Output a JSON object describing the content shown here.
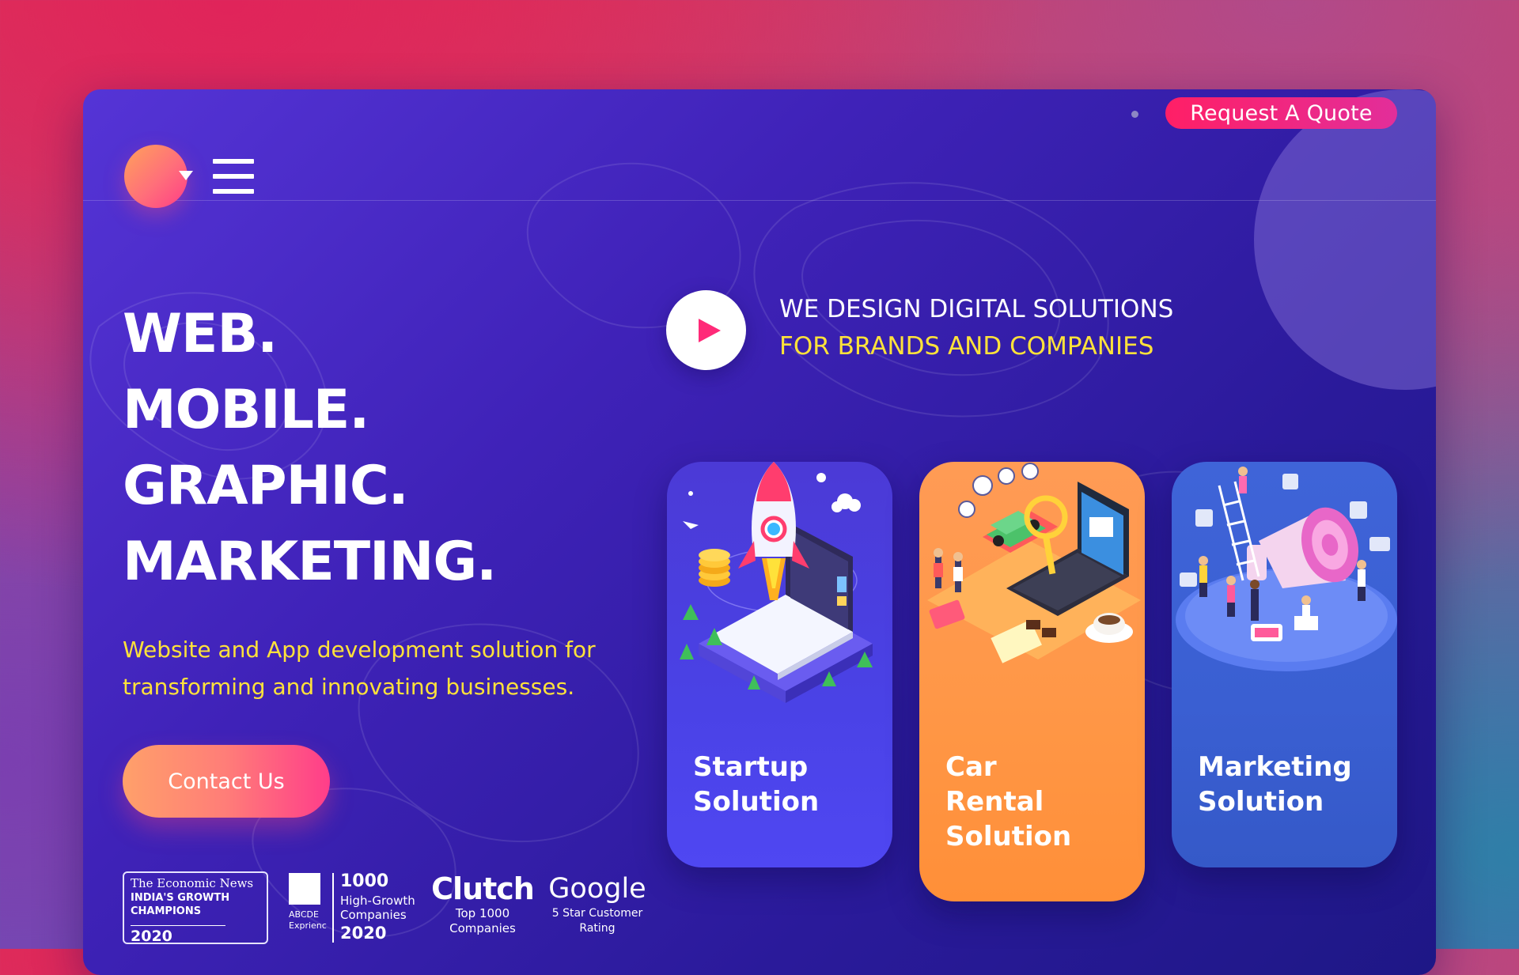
{
  "header": {
    "quote_button": "Request A Quote",
    "menu_icon": "hamburger-icon",
    "logo_icon": "logo-circle-icon"
  },
  "hero": {
    "headline": [
      "WEB.",
      "MOBILE.",
      "GRAPHIC.",
      "MARKETING."
    ],
    "subtext": "Website and App development solution for transforming and innovating businesses.",
    "contact_button": "Contact Us"
  },
  "tagline": {
    "line1": "WE DESIGN DIGITAL SOLUTIONS",
    "line2": "FOR BRANDS AND COMPANIES",
    "play_icon": "play-icon"
  },
  "cards": [
    {
      "title_lines": [
        "Startup",
        "Solution"
      ],
      "illustration": "rocket-laptop-illustration",
      "color": "#4b3ad6"
    },
    {
      "title_lines": [
        "Car",
        "Rental",
        "Solution"
      ],
      "illustration": "car-laptop-illustration",
      "color": "#ff9747"
    },
    {
      "title_lines": [
        "Marketing",
        "Solution"
      ],
      "illustration": "megaphone-illustration",
      "color": "#3a5fd2"
    }
  ],
  "badges": {
    "economic": {
      "line1": "The Economic News",
      "line2": "INDIA'S GROWTH",
      "line3": "CHAMPIONS",
      "year": "2020"
    },
    "growth": {
      "abc": "ABCDE Exprienc",
      "number": "1000",
      "label": "High-Growth Companies",
      "year": "2020"
    },
    "clutch": {
      "name": "Clutch",
      "line1": "Top 1000",
      "line2": "Companies"
    },
    "google": {
      "name": "Google",
      "line1": "5 Star Customer",
      "line2": "Rating"
    }
  },
  "colors": {
    "accent_pink": "#ff1f66",
    "accent_yellow": "#ffe23a",
    "frame_purple": "#3f22b8"
  }
}
